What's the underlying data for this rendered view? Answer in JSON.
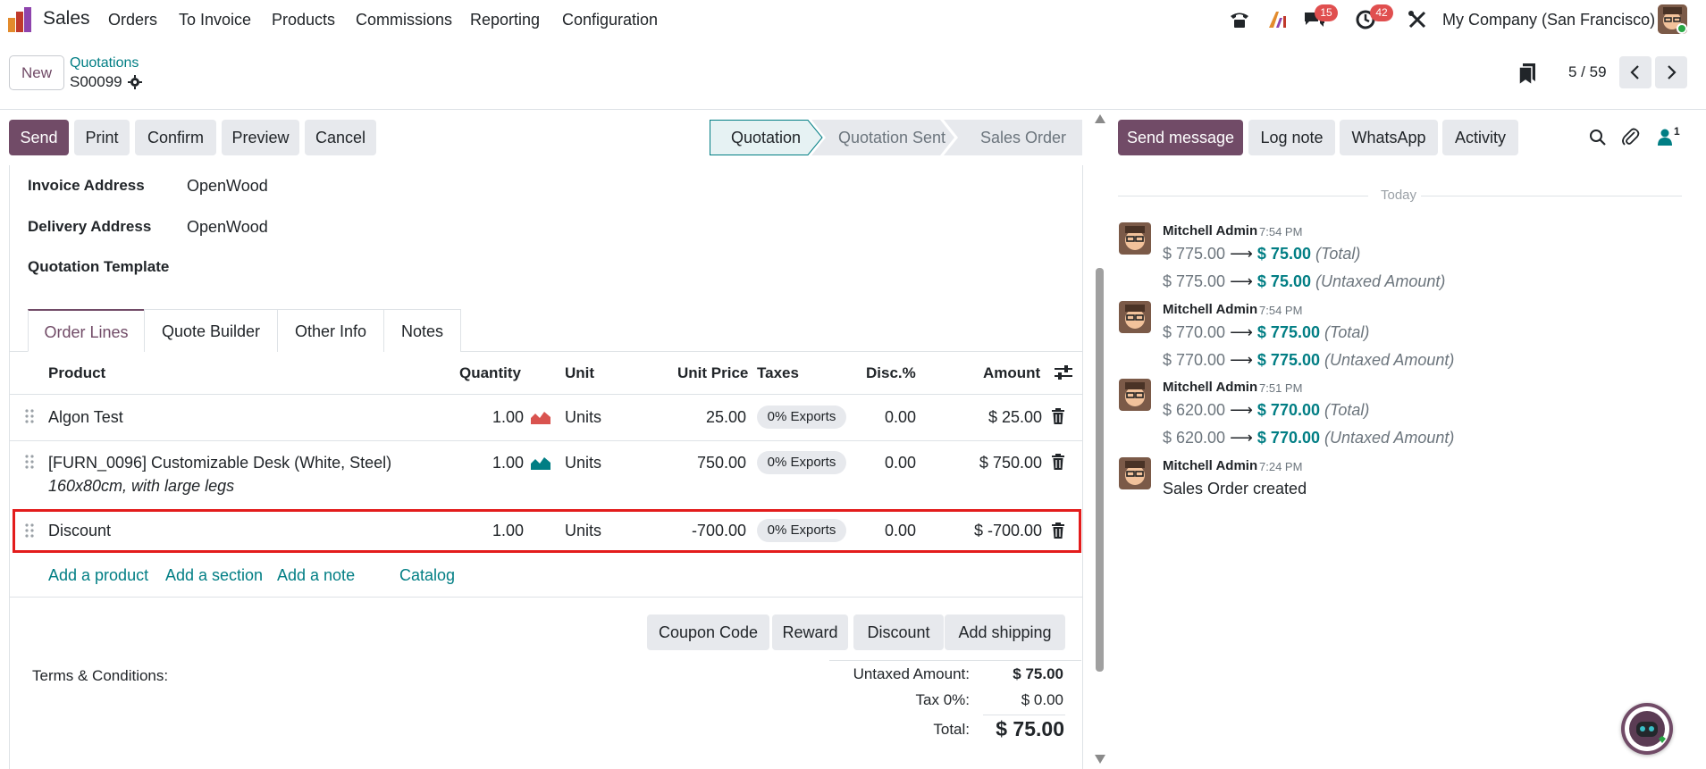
{
  "nav": {
    "app_name": "Sales",
    "menu": [
      "Orders",
      "To Invoice",
      "Products",
      "Commissions",
      "Reporting",
      "Configuration"
    ],
    "messages_count": "15",
    "activities_count": "42",
    "company": "My Company (San Francisco)"
  },
  "control": {
    "new_label": "New",
    "breadcrumb_parent": "Quotations",
    "breadcrumb_current": "S00099",
    "pager": "5 / 59"
  },
  "actions": {
    "send": "Send",
    "print": "Print",
    "confirm": "Confirm",
    "preview": "Preview",
    "cancel": "Cancel"
  },
  "statusbar": [
    "Quotation",
    "Quotation Sent",
    "Sales Order"
  ],
  "fields": {
    "invoice_label": "Invoice Address",
    "invoice_value": "OpenWood",
    "delivery_label": "Delivery Address",
    "delivery_value": "OpenWood",
    "template_label": "Quotation Template"
  },
  "tabs": [
    "Order Lines",
    "Quote Builder",
    "Other Info",
    "Notes"
  ],
  "columns": [
    "Product",
    "Quantity",
    "Unit",
    "Unit Price",
    "Taxes",
    "Disc.%",
    "Amount"
  ],
  "lines": [
    {
      "product": "Algon Test",
      "desc": "",
      "qty": "1.00",
      "unit": "Units",
      "price": "25.00",
      "tax": "0% Exports",
      "disc": "0.00",
      "amount": "$ 25.00"
    },
    {
      "product": "[FURN_0096] Customizable Desk (White, Steel)",
      "desc": "160x80cm, with large legs",
      "qty": "1.00",
      "unit": "Units",
      "price": "750.00",
      "tax": "0% Exports",
      "disc": "0.00",
      "amount": "$ 750.00"
    },
    {
      "product": "Discount",
      "desc": "",
      "qty": "1.00",
      "unit": "Units",
      "price": "-700.00",
      "tax": "0% Exports",
      "disc": "0.00",
      "amount": "$ -700.00"
    }
  ],
  "add_links": [
    "Add a product",
    "Add a section",
    "Add a note",
    "Catalog"
  ],
  "sale_buttons": [
    "Coupon Code",
    "Reward",
    "Discount",
    "Add shipping"
  ],
  "terms_label": "Terms & Conditions:",
  "totals": {
    "untaxed_label": "Untaxed Amount:",
    "untaxed": "$ 75.00",
    "tax_label": "Tax 0%:",
    "tax": "$ 0.00",
    "total_label": "Total:",
    "total": "$ 75.00"
  },
  "chatter": {
    "send_message": "Send message",
    "log_note": "Log note",
    "whatsapp": "WhatsApp",
    "activity": "Activity",
    "followers": "1",
    "today": "Today",
    "messages": [
      {
        "author": "Mitchell Admin",
        "time": "7:54 PM",
        "lines": [
          {
            "old": "$ 775.00",
            "new": "$ 75.00",
            "field": "(Total)"
          },
          {
            "old": "$ 775.00",
            "new": "$ 75.00",
            "field": "(Untaxed Amount)"
          }
        ]
      },
      {
        "author": "Mitchell Admin",
        "time": "7:54 PM",
        "lines": [
          {
            "old": "$ 770.00",
            "new": "$ 775.00",
            "field": "(Total)"
          },
          {
            "old": "$ 770.00",
            "new": "$ 775.00",
            "field": "(Untaxed Amount)"
          }
        ]
      },
      {
        "author": "Mitchell Admin",
        "time": "7:51 PM",
        "lines": [
          {
            "old": "$ 620.00",
            "new": "$ 770.00",
            "field": "(Total)"
          },
          {
            "old": "$ 620.00",
            "new": "$ 770.00",
            "field": "(Untaxed Amount)"
          }
        ]
      },
      {
        "author": "Mitchell Admin",
        "time": "7:24 PM",
        "body": "Sales Order created"
      }
    ]
  },
  "colors": {
    "brand": "#714b67",
    "link": "#017e84",
    "highlight": "#e31c1c"
  }
}
